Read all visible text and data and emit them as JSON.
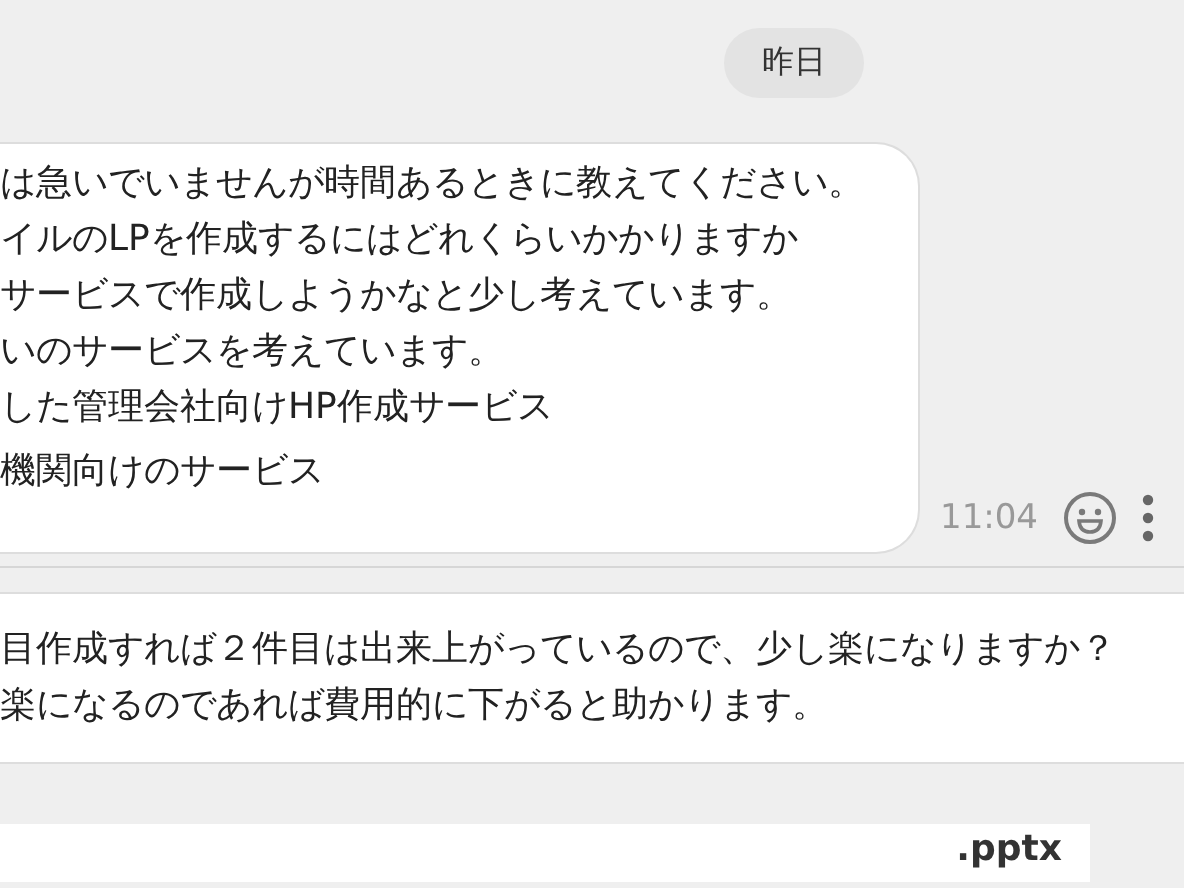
{
  "date_divider": "昨日",
  "message": {
    "lines": [
      "は急いでいませんが時間あるときに教えてください。",
      "イルのLPを作成するにはどれくらいかかりますか",
      "サービスで作成しようかなと少し考えています。",
      "いのサービスを考えています。",
      "した管理会社向けHP作成サービス",
      "機関向けのサービス"
    ],
    "time": "11:04"
  },
  "reply": {
    "lines": [
      "目作成すれば２件目は出来上がっているので、少し楽になりますか？",
      "楽になるのであれば費用的に下がると助かります。"
    ]
  },
  "file": {
    "name": ".pptx"
  }
}
